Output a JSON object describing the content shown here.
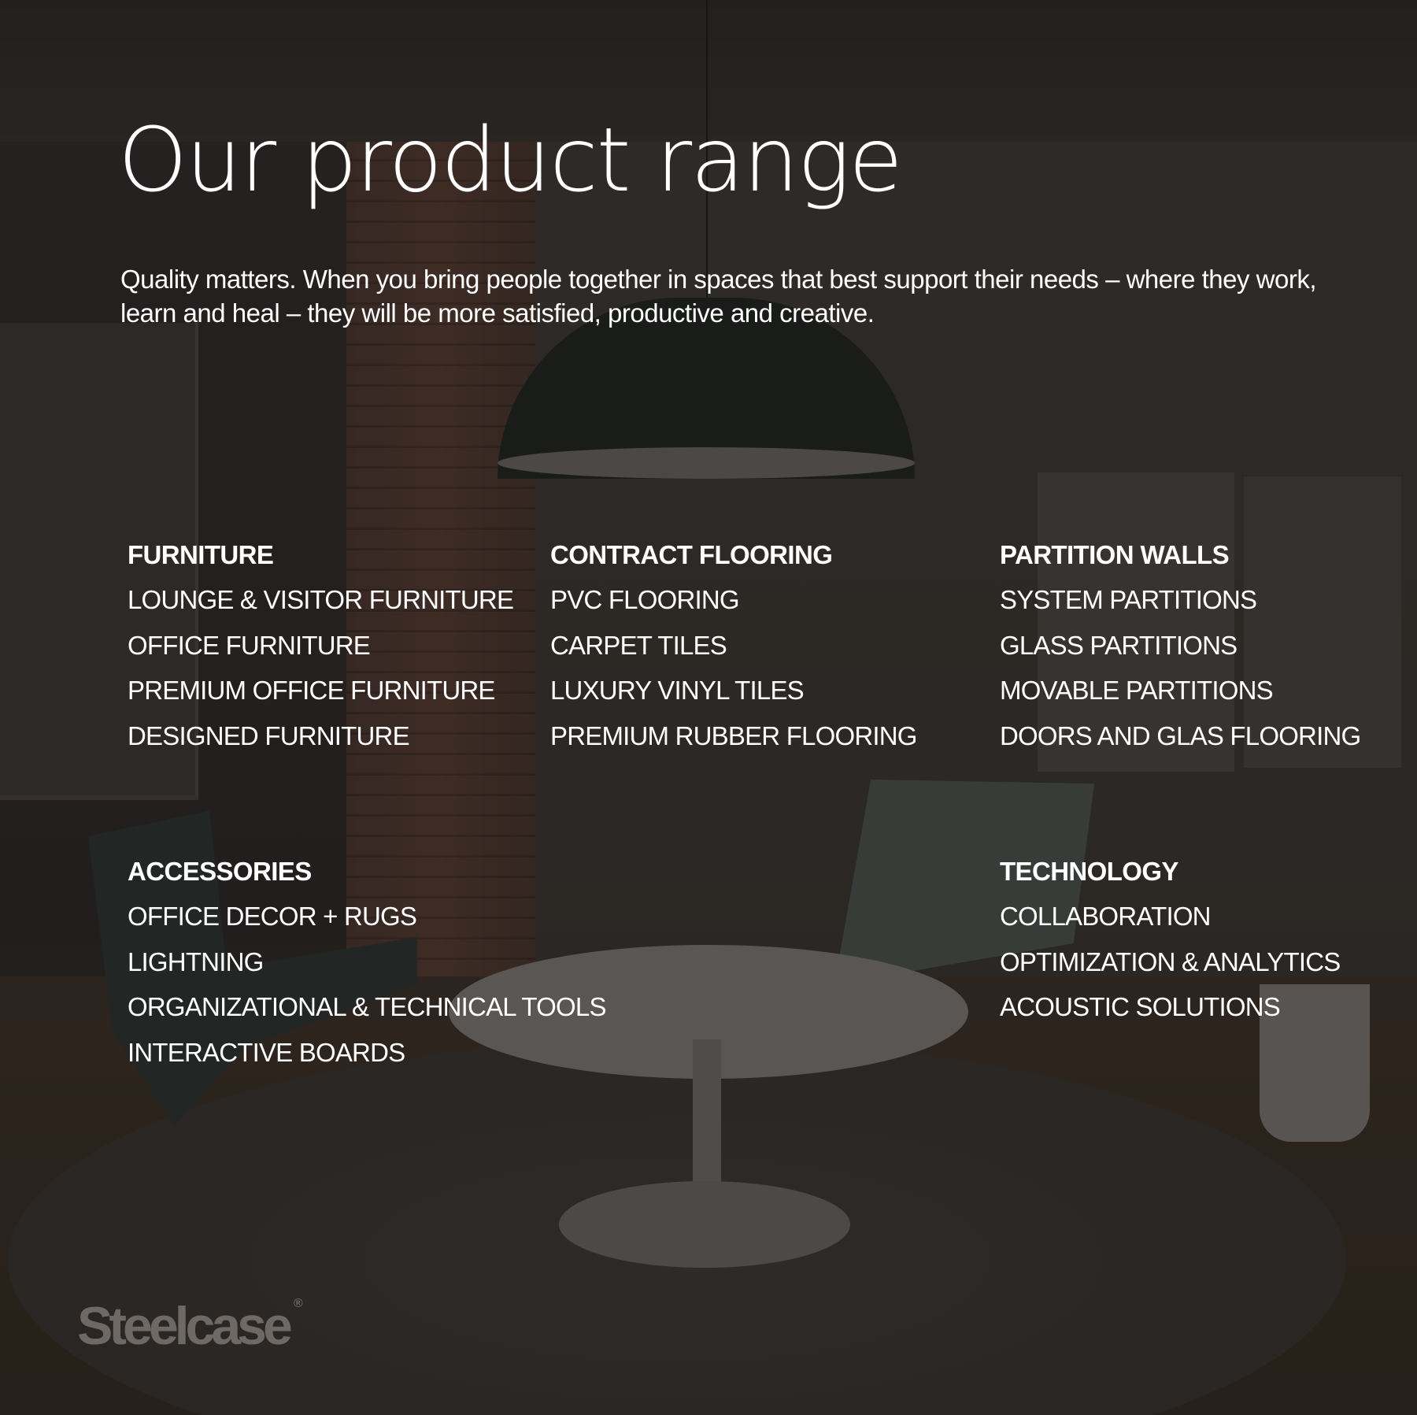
{
  "title": "Our product range",
  "intro": "Quality matters. When you bring people together in spaces that best support their needs – where they work, learn and heal – they will be more satisfied, productive and creative.",
  "categories": [
    {
      "heading": "FURNITURE",
      "items": [
        "LOUNGE & VISITOR FURNITURE",
        "OFFICE FURNITURE",
        "PREMIUM OFFICE FURNITURE",
        "DESIGNED FURNITURE"
      ]
    },
    {
      "heading": "CONTRACT FLOORING",
      "items": [
        "PVC FLOORING",
        "CARPET TILES",
        "LUXURY VINYL TILES",
        "PREMIUM RUBBER FLOORING"
      ]
    },
    {
      "heading": "PARTITION WALLS",
      "items": [
        "SYSTEM PARTITIONS",
        "GLASS PARTITIONS",
        "MOVABLE PARTITIONS",
        "DOORS AND GLAS FLOORING"
      ]
    },
    {
      "heading": "ACCESSORIES",
      "items": [
        "OFFICE DECOR + RUGS",
        "LIGHTNING",
        "ORGANIZATIONAL & TECHNICAL TOOLS",
        "INTERACTIVE BOARDS"
      ]
    },
    {
      "heading": "TECHNOLOGY",
      "items": [
        "COLLABORATION",
        "OPTIMIZATION & ANALYTICS",
        "ACOUSTIC SOLUTIONS"
      ]
    }
  ],
  "logo": {
    "text": "Steelcase",
    "mark": "®"
  },
  "colors": {
    "text": "#ffffff",
    "logo": "#6e6965",
    "background": "#2b2724"
  }
}
